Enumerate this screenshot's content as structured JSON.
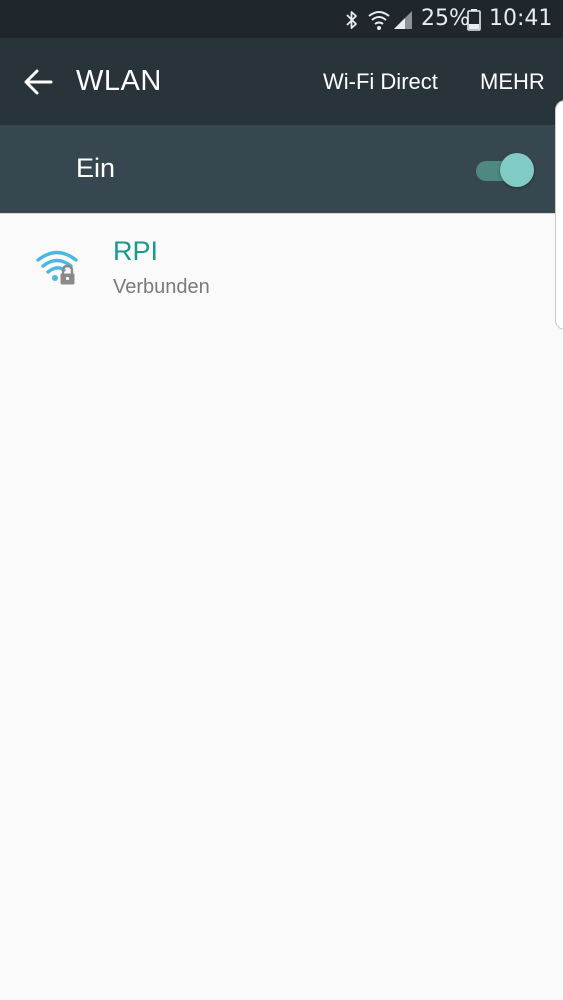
{
  "status_bar": {
    "icons": [
      "bluetooth-icon",
      "wifi-signal-icon",
      "cell-signal-icon",
      "battery-icon"
    ],
    "battery_percent": "25%",
    "time": "10:41"
  },
  "app_bar": {
    "back_icon": "arrow-back-icon",
    "title": "WLAN",
    "wifi_direct_label": "Wi-Fi Direct",
    "more_label": "MEHR"
  },
  "wifi_switch": {
    "label": "Ein",
    "state": "on",
    "accent_color": "#80cbc4"
  },
  "networks": [
    {
      "name": "RPI",
      "status": "Verbunden",
      "icon": "wifi-lock-icon",
      "color": "#199a8d"
    }
  ],
  "colors": {
    "status_bar_bg": "#1f262c",
    "app_bar_bg": "#28333a",
    "switch_bar_bg": "#37474f",
    "accent": "#199a8d",
    "wifi_icon": "#4cb8e0"
  }
}
